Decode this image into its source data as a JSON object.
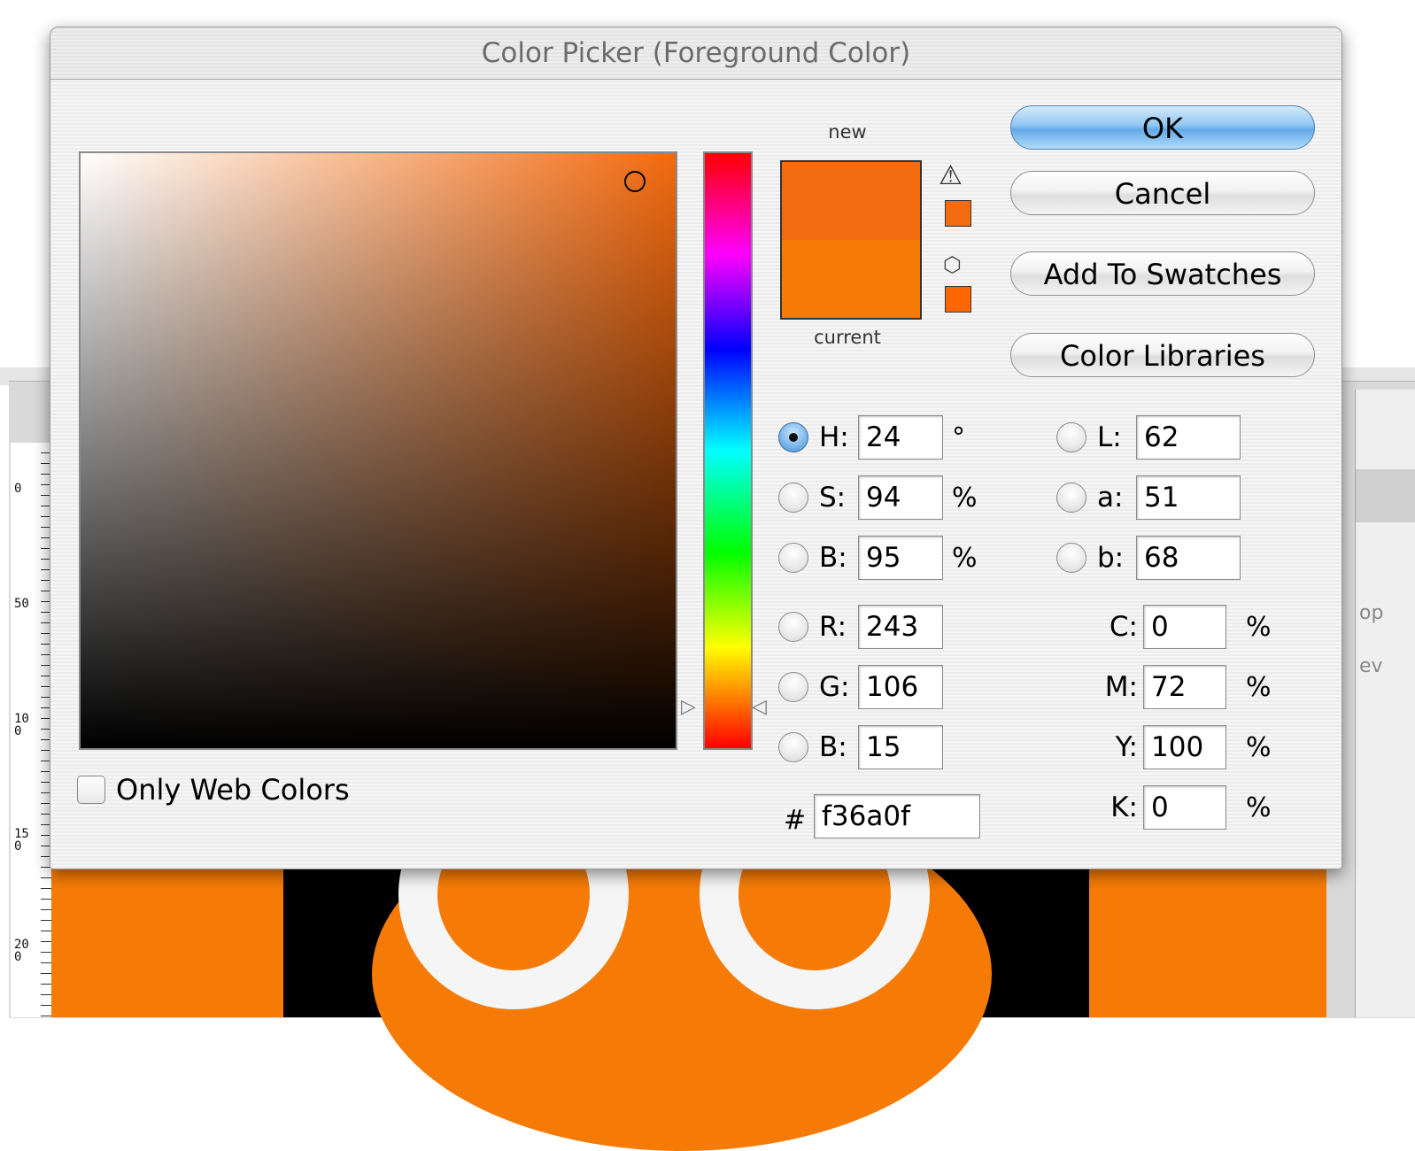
{
  "dialog": {
    "title": "Color Picker (Foreground Color)"
  },
  "buttons": {
    "ok": "OK",
    "cancel": "Cancel",
    "add_to_swatches": "Add To Swatches",
    "color_libraries": "Color Libraries"
  },
  "swatch": {
    "new_label": "new",
    "current_label": "current",
    "new_color": "#f36a0f",
    "current_color": "#f57b06",
    "gamut_warning_icon": "warning-triangle-icon",
    "web_safe_icon": "cube-icon",
    "gamut_color": "#f36a0f",
    "web_color": "#ff6600"
  },
  "only_web_colors": {
    "label": "Only Web Colors",
    "checked": false
  },
  "hsb": {
    "h_label": "H:",
    "h_value": "24",
    "h_unit": "°",
    "s_label": "S:",
    "s_value": "94",
    "s_unit": "%",
    "b_label": "B:",
    "b_value": "95",
    "b_unit": "%"
  },
  "rgb": {
    "r_label": "R:",
    "r_value": "243",
    "g_label": "G:",
    "g_value": "106",
    "b_label": "B:",
    "b_value": "15"
  },
  "lab": {
    "l_label": "L:",
    "l_value": "62",
    "a_label": "a:",
    "a_value": "51",
    "b_label": "b:",
    "b_value": "68"
  },
  "cmyk": {
    "c_label": "C:",
    "c_value": "0",
    "c_unit": "%",
    "m_label": "M:",
    "m_value": "72",
    "m_unit": "%",
    "y_label": "Y:",
    "y_value": "100",
    "y_unit": "%",
    "k_label": "K:",
    "k_value": "0",
    "k_unit": "%"
  },
  "hex": {
    "label": "#",
    "value": "f36a0f"
  },
  "selected_mode": "H",
  "colors": {
    "accent_button": "#63a9e8",
    "canvas_orange": "#f57b06"
  },
  "ruler": {
    "labels": [
      "0",
      "50",
      "100",
      "150",
      "200"
    ]
  },
  "background_panel": {
    "text_1": "op",
    "text_2": "ev"
  }
}
